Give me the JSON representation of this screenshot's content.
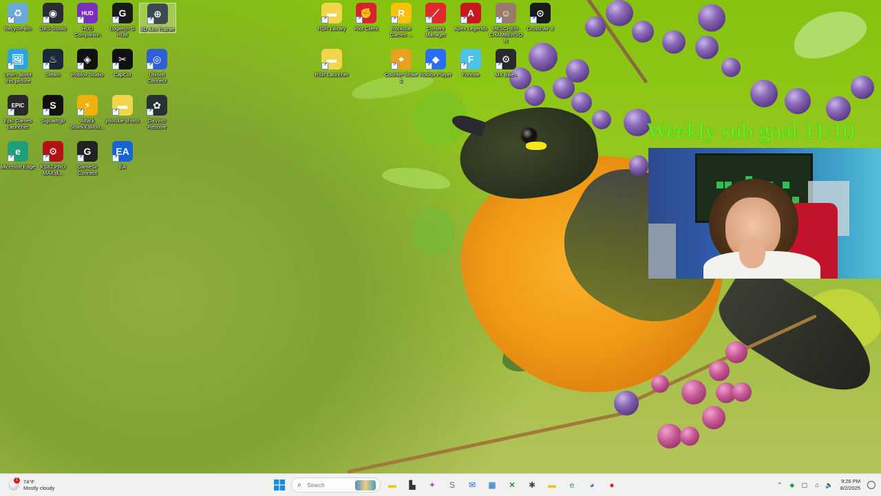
{
  "desktop": {
    "icons": [
      {
        "label": "Recycle Bin",
        "glyph": "♻",
        "color": "#6aa9d8"
      },
      {
        "label": "OBS Studio",
        "glyph": "◉",
        "color": "#2b2b33"
      },
      {
        "label": "HUD Companion",
        "glyph": "HUD",
        "color": "#7a2fbf"
      },
      {
        "label": "Logitech G HUB",
        "glyph": "G",
        "color": "#1a1a1a"
      },
      {
        "label": "3D Aim Trainer",
        "glyph": "⊕",
        "color": "#3e4a52"
      },
      {
        "label": "Learn about this picture",
        "glyph": "🖼",
        "color": "#2aa3e0"
      },
      {
        "label": "Steam",
        "glyph": "♨",
        "color": "#1b2838"
      },
      {
        "label": "Roblox Studio",
        "glyph": "◈",
        "color": "#111111"
      },
      {
        "label": "CapCut",
        "glyph": "✂",
        "color": "#111111"
      },
      {
        "label": "Ubisoft Connect",
        "glyph": "◎",
        "color": "#2e5fd6"
      },
      {
        "label": "Epic Games Launcher",
        "glyph": "EPIC",
        "color": "#2a2a2a"
      },
      {
        "label": "SignalRgb",
        "glyph": "S",
        "color": "#111111"
      },
      {
        "label": "Attack SharkX3Mou...",
        "glyph": "⚡",
        "color": "#f0b010"
      },
      {
        "label": "youtube shorts",
        "glyph": "▬",
        "color": "#f2d54a"
      },
      {
        "label": "DaVinci Resolve",
        "glyph": "✿",
        "color": "#263238"
      },
      {
        "label": "Microsoft Edge",
        "glyph": "e",
        "color": "#1fa07a"
      },
      {
        "label": "KS82 PRO MAX铁...",
        "glyph": "⚙",
        "color": "#b31212"
      },
      {
        "label": "GameSir Connect",
        "glyph": "G",
        "color": "#222222"
      },
      {
        "label": "EA",
        "glyph": "EA",
        "color": "#1565d8"
      },
      {
        "label": "RSR Library",
        "glyph": "▬",
        "color": "#f2d54a"
      },
      {
        "label": "Riot Client",
        "glyph": "✊",
        "color": "#d8232a"
      },
      {
        "label": "Rockstar Games ...",
        "glyph": "R",
        "color": "#f7c20c"
      },
      {
        "label": "Content Manager",
        "glyph": "⟋",
        "color": "#e02a2a"
      },
      {
        "label": "Apex Legends",
        "glyph": "A",
        "color": "#c8181e"
      },
      {
        "label": "MESCHER-CHAMBERSON",
        "glyph": "☺",
        "color": "#9a7b6a"
      },
      {
        "label": "Crosshair X",
        "glyph": "⊙",
        "color": "#1a1a1a"
      },
      {
        "label": "RSR Launcher",
        "glyph": "▬",
        "color": "#f2d54a"
      },
      {
        "label": "Counter-Strike 2",
        "glyph": "⌖",
        "color": "#e8a020"
      },
      {
        "label": "Roblox Player",
        "glyph": "◆",
        "color": "#2c6df5"
      },
      {
        "label": "Fortnite",
        "glyph": "F",
        "color": "#4cc3e8"
      },
      {
        "label": "MX Bikes",
        "glyph": "⚙",
        "color": "#2a2a2a"
      }
    ]
  },
  "overlay": {
    "sub_goal_text": "Weekly sub goal 11/10"
  },
  "taskbar": {
    "weather_temp": "74°F",
    "weather_desc": "Mostly cloudy",
    "weather_badge": "1",
    "search_placeholder": "Search",
    "time": "9:26 PM",
    "date": "8/2/2025",
    "pinned": [
      {
        "name": "file-explorer",
        "glyph": "▬",
        "color": "#f0c419"
      },
      {
        "name": "task-manager",
        "glyph": "▙",
        "color": "#333333"
      },
      {
        "name": "copilot",
        "glyph": "✦",
        "color": "#c03fd0"
      },
      {
        "name": "app-s",
        "glyph": "S",
        "color": "#666666"
      },
      {
        "name": "outlook",
        "glyph": "✉",
        "color": "#1569c7"
      },
      {
        "name": "store",
        "glyph": "▦",
        "color": "#1569c7"
      },
      {
        "name": "xbox",
        "glyph": "✕",
        "color": "#107c10"
      },
      {
        "name": "spider-app",
        "glyph": "✱",
        "color": "#444444"
      },
      {
        "name": "folder",
        "glyph": "▬",
        "color": "#f0c419"
      },
      {
        "name": "edge",
        "glyph": "e",
        "color": "#1fa07a"
      },
      {
        "name": "discord",
        "glyph": "◕",
        "color": "#5865f2"
      },
      {
        "name": "app-red",
        "glyph": "●",
        "color": "#d82424"
      }
    ]
  }
}
